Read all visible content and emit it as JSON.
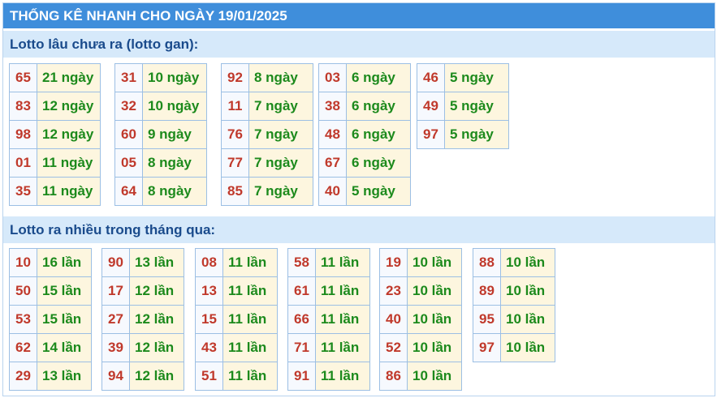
{
  "title": "THỐNG KÊ NHANH CHO NGÀY 19/01/2025",
  "section1": {
    "heading": "Lotto lâu chưa ra (lotto gan):",
    "groups": [
      [
        [
          "65",
          "21 ngày"
        ],
        [
          "83",
          "12 ngày"
        ],
        [
          "98",
          "12 ngày"
        ],
        [
          "01",
          "11 ngày"
        ],
        [
          "35",
          "11 ngày"
        ]
      ],
      [
        [
          "31",
          "10 ngày"
        ],
        [
          "32",
          "10 ngày"
        ],
        [
          "60",
          "9 ngày"
        ],
        [
          "05",
          "8 ngày"
        ],
        [
          "64",
          "8 ngày"
        ]
      ],
      [
        [
          "92",
          "8 ngày"
        ],
        [
          "11",
          "7 ngày"
        ],
        [
          "76",
          "7 ngày"
        ],
        [
          "77",
          "7 ngày"
        ],
        [
          "85",
          "7 ngày"
        ]
      ],
      [
        [
          "03",
          "6 ngày"
        ],
        [
          "38",
          "6 ngày"
        ],
        [
          "48",
          "6 ngày"
        ],
        [
          "67",
          "6 ngày"
        ],
        [
          "40",
          "5 ngày"
        ]
      ],
      [
        [
          "46",
          "5 ngày"
        ],
        [
          "49",
          "5 ngày"
        ],
        [
          "97",
          "5 ngày"
        ]
      ]
    ]
  },
  "section2": {
    "heading": "Lotto ra nhiều trong tháng qua:",
    "groups": [
      [
        [
          "10",
          "16 lần"
        ],
        [
          "50",
          "15 lần"
        ],
        [
          "53",
          "15 lần"
        ],
        [
          "62",
          "14 lần"
        ],
        [
          "29",
          "13 lần"
        ]
      ],
      [
        [
          "90",
          "13 lần"
        ],
        [
          "17",
          "12 lần"
        ],
        [
          "27",
          "12 lần"
        ],
        [
          "39",
          "12 lần"
        ],
        [
          "94",
          "12 lần"
        ]
      ],
      [
        [
          "08",
          "11 lần"
        ],
        [
          "13",
          "11 lần"
        ],
        [
          "15",
          "11 lần"
        ],
        [
          "43",
          "11 lần"
        ],
        [
          "51",
          "11 lần"
        ]
      ],
      [
        [
          "58",
          "11 lần"
        ],
        [
          "61",
          "11 lần"
        ],
        [
          "66",
          "11 lần"
        ],
        [
          "71",
          "11 lần"
        ],
        [
          "91",
          "11 lần"
        ]
      ],
      [
        [
          "19",
          "10 lần"
        ],
        [
          "23",
          "10 lần"
        ],
        [
          "40",
          "10 lần"
        ],
        [
          "52",
          "10 lần"
        ],
        [
          "86",
          "10 lần"
        ]
      ],
      [
        [
          "88",
          "10 lần"
        ],
        [
          "89",
          "10 lần"
        ],
        [
          "95",
          "10 lần"
        ],
        [
          "97",
          "10 lần"
        ]
      ]
    ]
  }
}
